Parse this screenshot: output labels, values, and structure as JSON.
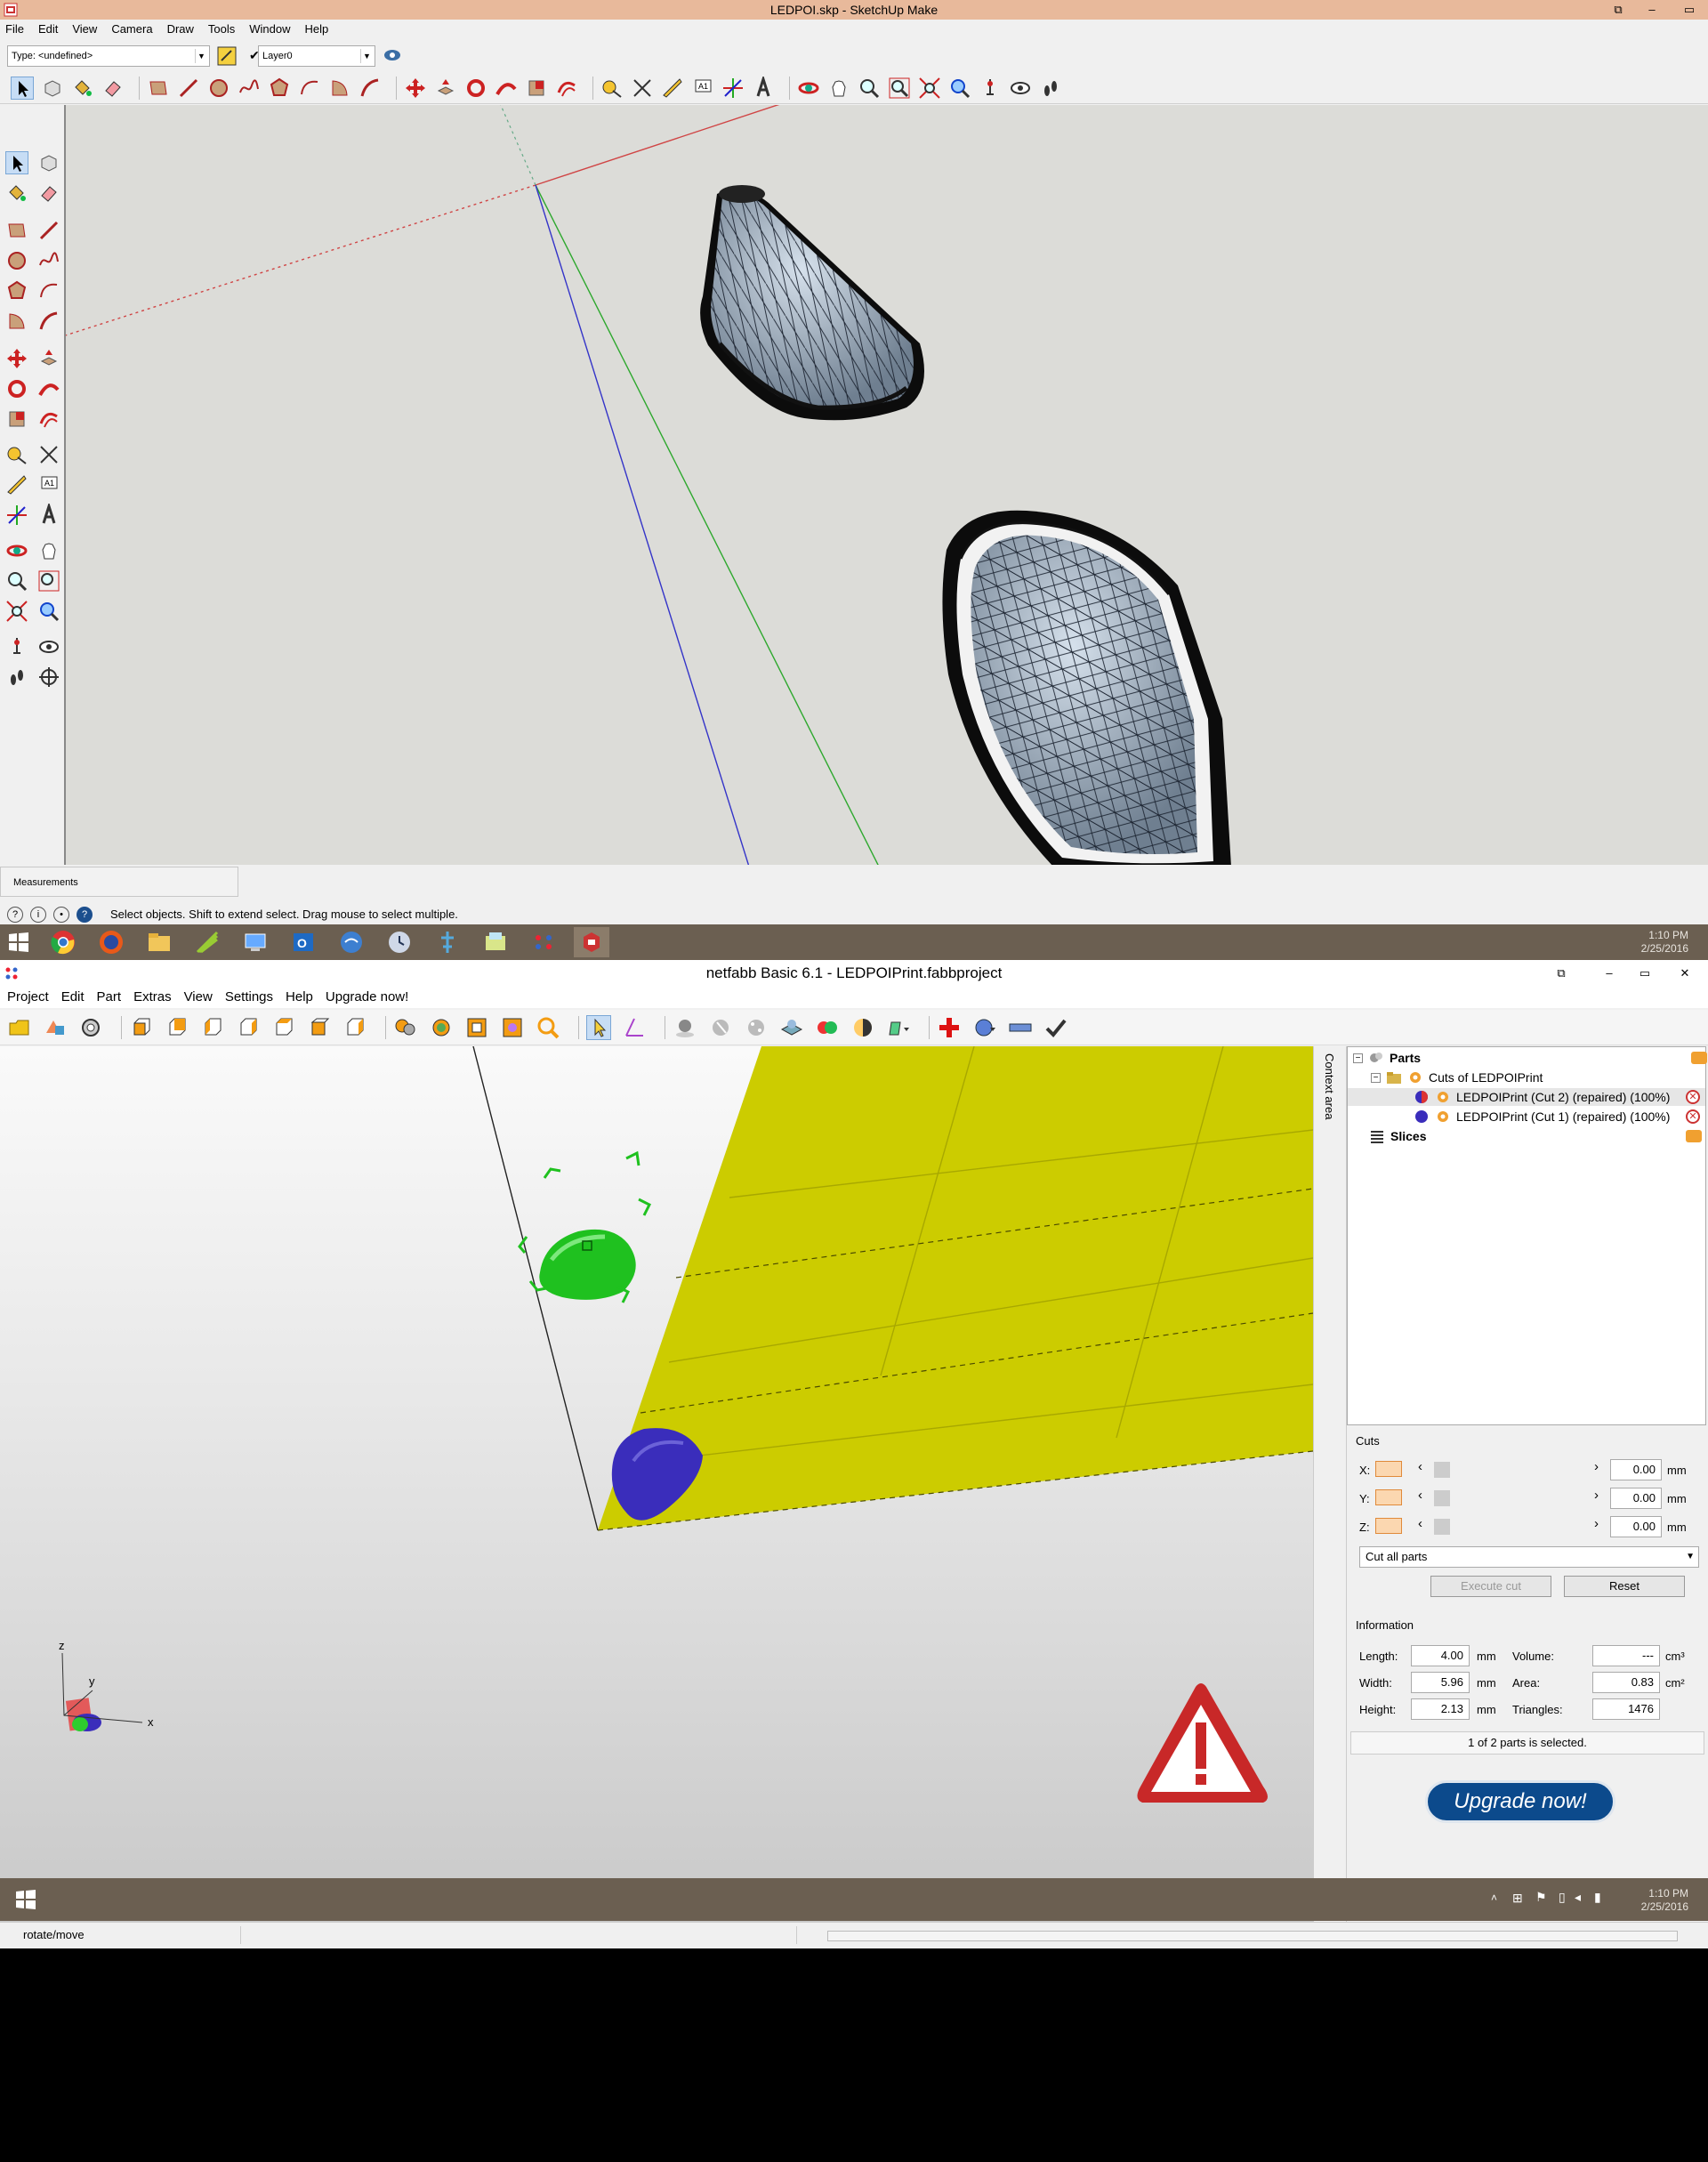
{
  "sketchup": {
    "title": "LEDPOI.skp - SketchUp Make",
    "menu": [
      "File",
      "Edit",
      "View",
      "Camera",
      "Draw",
      "Tools",
      "Window",
      "Help"
    ],
    "type_combo": "Type: <undefined>",
    "layer_combo": "Layer0",
    "measurements_label": "Measurements",
    "status_text": "Select objects. Shift to extend select. Drag mouse to select multiple."
  },
  "taskbar_top": {
    "time": "1:10 PM",
    "date": "2/25/2016",
    "apps": [
      "start-icon",
      "chrome-icon",
      "firefox-icon",
      "explorer-icon",
      "sketchup-leaf-icon",
      "network-icon",
      "outlook-icon",
      "wifi-icon",
      "clock-icon",
      "pin-icon",
      "folder-icon",
      "netfabb-icon",
      "sketchup-icon"
    ]
  },
  "netfabb": {
    "title": "netfabb Basic 6.1 - LEDPOIPrint.fabbproject",
    "menu": [
      "Project",
      "Edit",
      "Part",
      "Extras",
      "View",
      "Settings",
      "Help",
      "Upgrade now!"
    ],
    "context_label": "Context area",
    "tree": {
      "parts": "Parts",
      "cuts_group": "Cuts of LEDPOIPrint",
      "cut2": "LEDPOIPrint (Cut 2) (repaired) (100%)",
      "cut1": "LEDPOIPrint (Cut 1) (repaired) (100%)",
      "slices": "Slices"
    },
    "cuts": {
      "title": "Cuts",
      "x_label": "X:",
      "y_label": "Y:",
      "z_label": "Z:",
      "x_value": "0.00",
      "y_value": "0.00",
      "z_value": "0.00",
      "unit": "mm",
      "mode": "Cut all parts",
      "execute": "Execute cut",
      "reset": "Reset"
    },
    "info": {
      "title": "Information",
      "length_label": "Length:",
      "length": "4.00",
      "width_label": "Width:",
      "width": "5.96",
      "height_label": "Height:",
      "height": "2.13",
      "volume_label": "Volume:",
      "volume": "---",
      "area_label": "Area:",
      "area": "0.83",
      "triangles_label": "Triangles:",
      "triangles": "1476",
      "unit_mm": "mm",
      "unit_cm3": "cm³",
      "unit_cm2": "cm²",
      "selection": "1 of 2 parts is selected."
    },
    "upgrade_button": "Upgrade now!",
    "status_text": "rotate/move",
    "axis_x": "x",
    "axis_y": "y",
    "axis_z": "z",
    "colors": {
      "plate": "#cccc00",
      "selected_part": "#1fc11f",
      "other_part": "#3a2dbb",
      "warning": "#cc2222"
    }
  },
  "taskbar_bottom": {
    "time": "1:10 PM",
    "date": "2/25/2016"
  }
}
